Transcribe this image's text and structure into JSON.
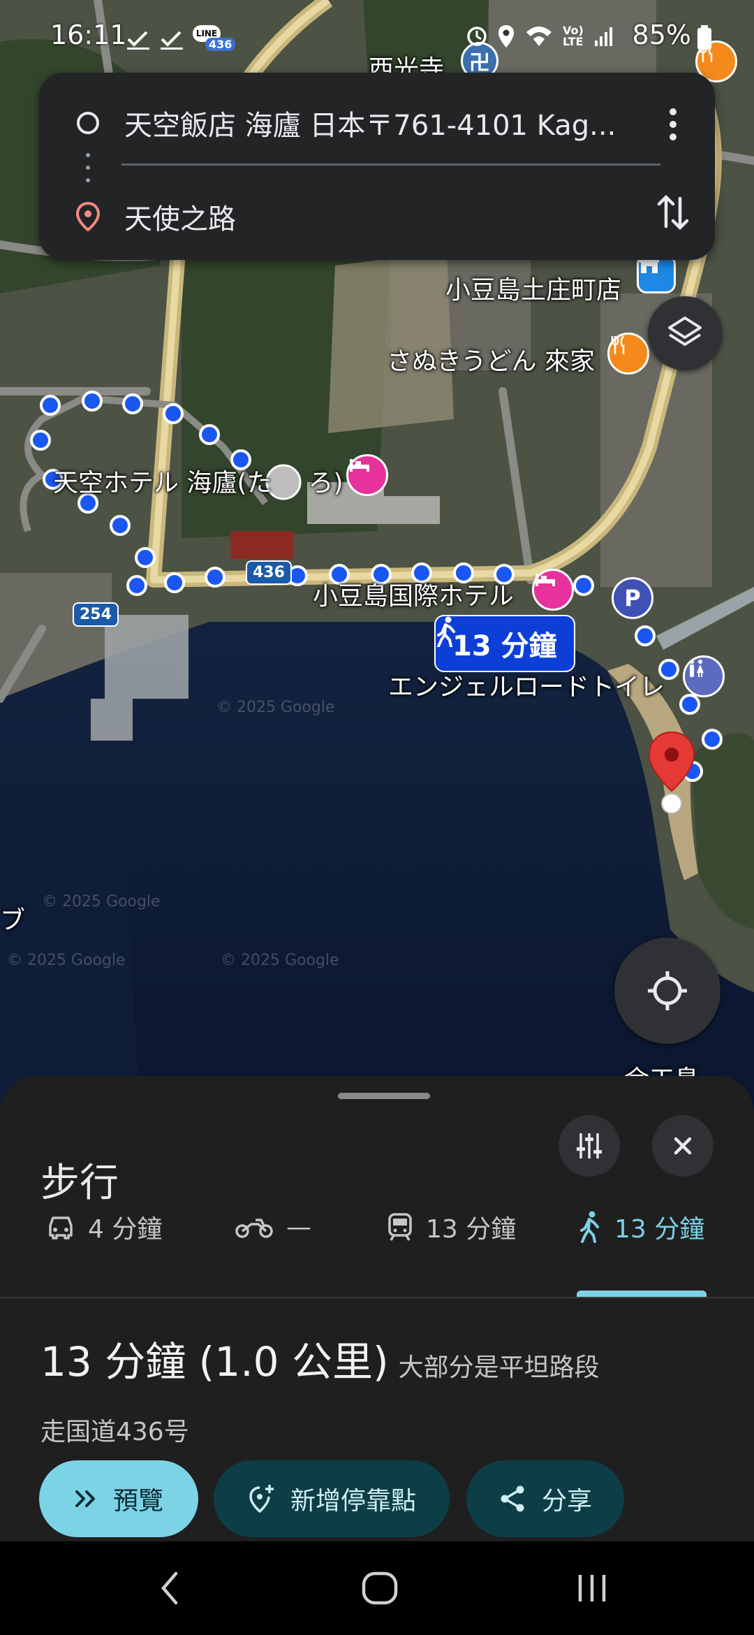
{
  "status_bar": {
    "time": "16:11",
    "notification_badge": "436",
    "battery": "85%"
  },
  "directions": {
    "origin": "天空飯店 海廬 日本〒761-4101 Kag...",
    "destination": "天使之路"
  },
  "map": {
    "labels": {
      "seiko_temple": "西光寺",
      "shodoshima_tonosho": "小豆島土庄町店",
      "sanuki_udon": "さぬきうどん 來家",
      "tenku_hotel": "天空ホテル 海廬(た",
      "tenku_hotel_tail": "ろ)",
      "kokusai_hotel": "小豆島国際ホテル",
      "angel_road_toilet": "エンジェルロードトイレ",
      "edge_bu": "ブ",
      "edge_yoshi": "余工島"
    },
    "road_shields": {
      "r436": "436",
      "r254": "254"
    },
    "parking_letter": "P",
    "watermarks": [
      "© 2025 Google",
      "© 2025 Google",
      "© 2025 Google",
      "© 2025 Google"
    ],
    "walk_bubble": "13 分鐘"
  },
  "sheet": {
    "title": "步行",
    "modes": [
      {
        "icon": "car-icon",
        "label": "4 分鐘"
      },
      {
        "icon": "motorcycle-icon",
        "label": "—"
      },
      {
        "icon": "train-icon",
        "label": "13 分鐘"
      },
      {
        "icon": "walk-icon",
        "label": "13 分鐘",
        "active": true
      }
    ],
    "summary_main": "13 分鐘 (1.0 公里)",
    "summary_sub": "大部分是平坦路段",
    "via": "走国道436号",
    "actions": {
      "preview": "預覽",
      "add_stop": "新增停靠點",
      "share": "分享"
    }
  },
  "colors": {
    "route_dot": "#1a56f0",
    "active_mode": "#7cd3e6",
    "destination_pin": "#e53935",
    "hotel_pin": "#e8329b",
    "restaurant_pin": "#f48a1c"
  }
}
